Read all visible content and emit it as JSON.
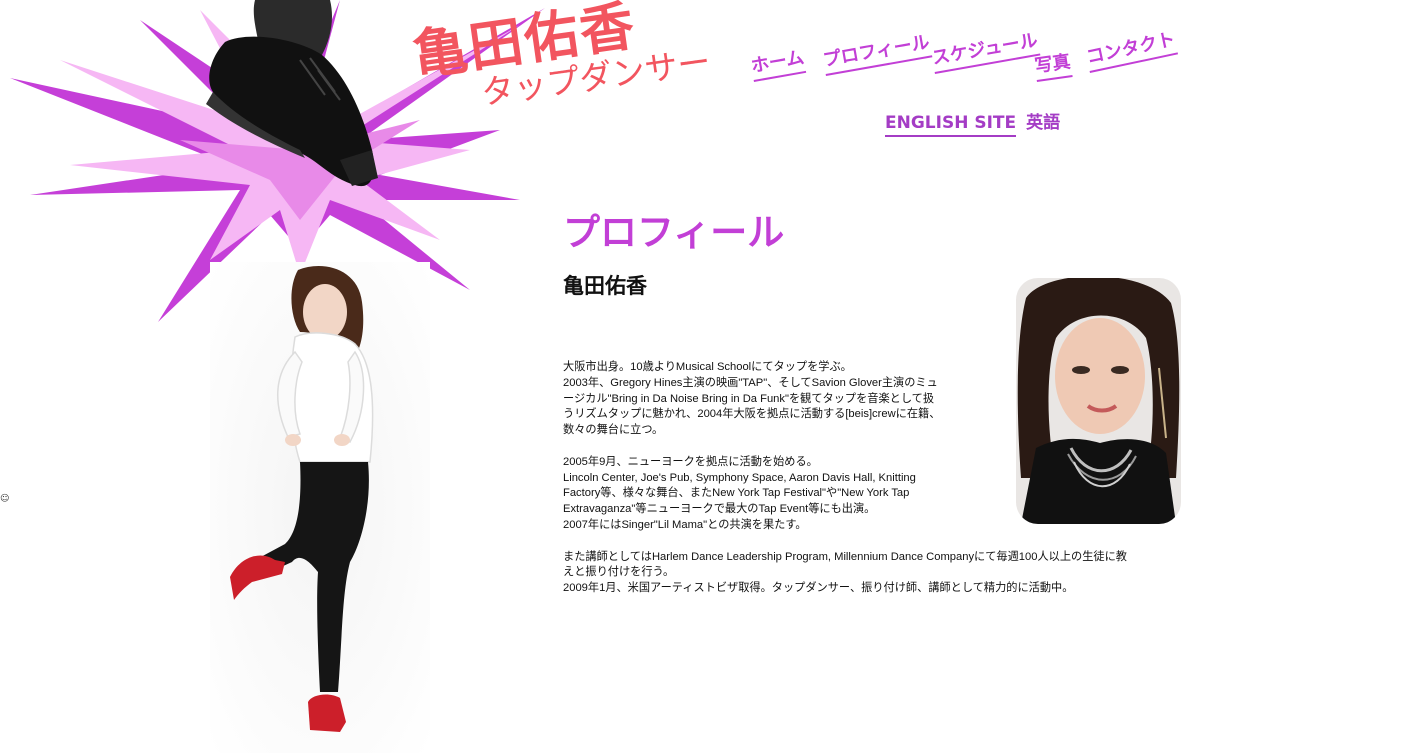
{
  "site": {
    "title_name": "亀田佑香",
    "title_sub": "タップダンサー"
  },
  "nav": {
    "items": [
      {
        "label": "ホーム"
      },
      {
        "label": "プロフィール"
      },
      {
        "label": "スケジュール"
      },
      {
        "label": "写真"
      },
      {
        "label": "コンタクト"
      }
    ],
    "english_site": "ENGLISH SITE",
    "english_label": "英語"
  },
  "misc": {
    "emoticon": "☺"
  },
  "content": {
    "heading": "プロフィール",
    "name": "亀田佑香",
    "bio": {
      "p1": [
        "大阪市出身。10歳よりMusical Schoolにてタップを学ぶ。",
        "2003年、Gregory Hines主演の映画\"TAP\"、そしてSavion Glover主演のミュ",
        "ージカル\"Bring in Da Noise Bring in Da Funk\"を観てタップを音楽として扱",
        "うリズムタップに魅かれ、2004年大阪を拠点に活動する[beis]crewに在籍、",
        "数々の舞台に立つ。"
      ],
      "p2": [
        "2005年9月、ニューヨークを拠点に活動を始める。",
        "Lincoln Center, Joe's Pub, Symphony Space, Aaron Davis Hall, Knitting",
        "Factory等、様々な舞台、またNew York Tap Festival\"や\"New York Tap",
        "Extravaganza\"等ニューヨークで最大のTap Event等にも出演。",
        "2007年にはSinger\"Lil Mama\"との共演を果たす。"
      ],
      "p3": [
        "また講師としてはHarlem Dance Leadership Program, Millennium Dance Companyにて毎週100人以上の生徒に教",
        "えと振り付けを行う。",
        "2009年1月、米国アーティストビザ取得。タップダンサー、振り付け師、講師として精力的に活動中。"
      ]
    }
  },
  "colors": {
    "accent_purple": "#c23fd6",
    "burst_light": "#f6b7f4",
    "burst_dark": "#c53fd8",
    "title_red": "#f2555f"
  }
}
